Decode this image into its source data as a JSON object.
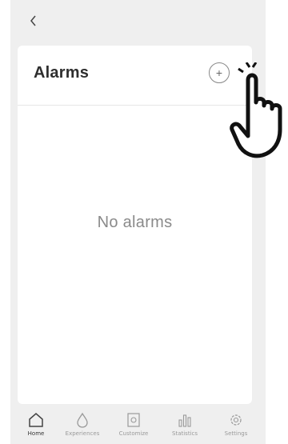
{
  "header": {
    "back_icon": "chevron-left-icon"
  },
  "alarms": {
    "title": "Alarms",
    "add_icon": "plus-icon",
    "empty_text": "No alarms"
  },
  "tabs": [
    {
      "label": "Home",
      "icon": "home-icon",
      "active": true
    },
    {
      "label": "Experiences",
      "icon": "droplet-icon",
      "active": false
    },
    {
      "label": "Customize",
      "icon": "customize-icon",
      "active": false
    },
    {
      "label": "Statistics",
      "icon": "bar-chart-icon",
      "active": false
    },
    {
      "label": "Settings",
      "icon": "gear-icon",
      "active": false
    }
  ]
}
